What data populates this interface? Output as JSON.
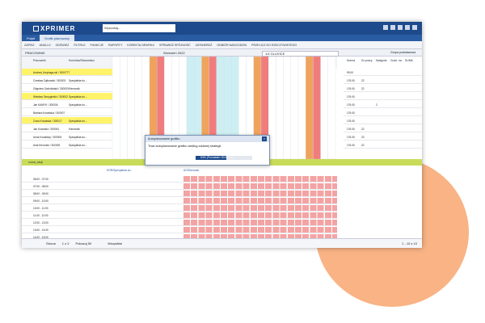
{
  "app": {
    "logo": "XPRIMER",
    "search": "Wyszukaj..."
  },
  "tabs": [
    {
      "label": "Pulpit"
    },
    {
      "label": "Grafik planowany"
    }
  ],
  "toolbar": [
    "ZAPISZ",
    "ANULUJ",
    "ODŚWIEŻ",
    "FILTRUJ",
    "FUNKCJE",
    "RAPORTY",
    "KOREKTA GRAFIKU",
    "SPRAWDŹ SPÓJNOŚĆ",
    "ZATWIERDŹ",
    "ODBIÓR NADGODZIN",
    "PRZELICZ DO RZECZYWISTEGO"
  ],
  "filter": {
    "left": "PRACOWNIK",
    "month": "Wrzesień 2022",
    "week": "1/4 GLUVICE",
    "right": "Grupa podstawowa"
  },
  "columns": {
    "employee": "Pracownik",
    "position": "Komórka/Stanowisko",
    "right": [
      "Norma",
      "Do pracy",
      "Nadgodz.",
      "Godz. na.",
      "SUMA"
    ]
  },
  "employees": [
    {
      "name": "Andrzej Urzykaga-ski / 3000777",
      "pos": ""
    },
    {
      "name": "Czesław Żąłkowski / 300003",
      "pos": "Specjalista do..."
    },
    {
      "name": "Zbigniew Gwiżdżalski / 300003",
      "pos": "Kierownik"
    },
    {
      "name": "Wiesław Szmygielski / 300002",
      "pos": "Specjalista do..."
    },
    {
      "name": "Jan KAMYK / 300006",
      "pos": "Specjalista do..."
    },
    {
      "name": "Barbara Kowalska / 300007",
      "pos": ""
    },
    {
      "name": "Zuzia Kowalska / 300017",
      "pos": "Specjalista do..."
    },
    {
      "name": "Jan Kowalski / 300004",
      "pos": "Kierownik"
    },
    {
      "name": "Anna Kowalsky / 300005",
      "pos": "Specjalista do..."
    },
    {
      "name": "Ania Kierunek / 300005",
      "pos": "Specjalista do..."
    }
  ],
  "summary_label": "suma_akcji",
  "hours": [
    "06:00 - 07:00",
    "07:00 - 08:00",
    "08:00 - 09:00",
    "09:00 - 10:00",
    "10:00 - 11:00",
    "11:00 - 12:00",
    "12:00 - 13:00",
    "13:00 - 14:00",
    "14:00 - 15:00"
  ],
  "bottom_headers": [
    "SOR/Specjalista do...",
    "AG/Kierunek"
  ],
  "modal": {
    "title": "Autoplanowanie grafiku",
    "message": "Trwa autoplanowanie grafiku według zadanej strategii.",
    "progress_label": "54% (Pozostało: 00:00:11)",
    "progress": 0.54
  },
  "footer": {
    "rows": "Strona",
    "page": "1 z 2",
    "perpage": "Pokazuj 50",
    "check": "Wszystkie",
    "count": "1 - 10 z 10"
  },
  "right_values": [
    {
      "a": "99.00",
      "b": "",
      "c": "",
      "d": ""
    },
    {
      "a": "176.00",
      "b": "22",
      "c": "",
      "d": ""
    },
    {
      "a": "176.00",
      "b": "22",
      "c": "",
      "d": ""
    },
    {
      "a": "176.00",
      "b": "",
      "c": "",
      "d": ""
    },
    {
      "a": "176.00",
      "b": "",
      "c": "2",
      "d": ""
    },
    {
      "a": "176.00",
      "b": "",
      "c": "",
      "d": ""
    },
    {
      "a": "176.00",
      "b": "",
      "c": "",
      "d": ""
    },
    {
      "a": "176.00",
      "b": "22",
      "c": "",
      "d": ""
    },
    {
      "a": "176.00",
      "b": "23",
      "c": "",
      "d": ""
    },
    {
      "a": "176.00",
      "b": "22",
      "c": "",
      "d": ""
    }
  ]
}
